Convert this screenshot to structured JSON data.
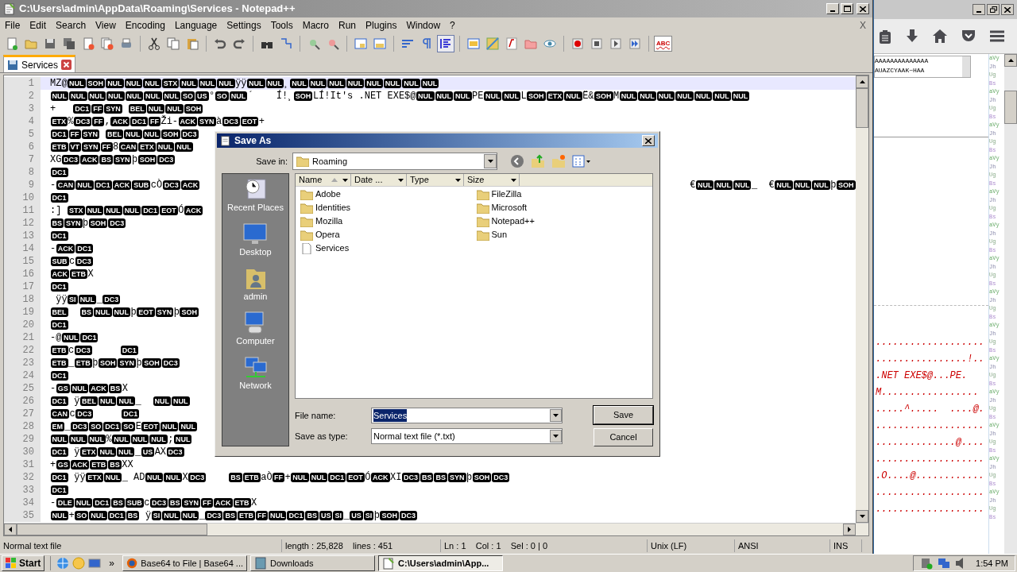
{
  "window": {
    "title": "C:\\Users\\admin\\AppData\\Roaming\\Services - Notepad++",
    "close_doc": "X"
  },
  "menu": [
    "File",
    "Edit",
    "Search",
    "View",
    "Encoding",
    "Language",
    "Settings",
    "Tools",
    "Macro",
    "Run",
    "Plugins",
    "Window",
    "?"
  ],
  "toolbar": [
    {
      "pressed": false
    },
    {
      "pressed": false
    },
    {
      "pressed": false
    },
    {
      "pressed": false
    },
    {
      "pressed": false
    },
    {
      "pressed": false
    },
    {
      "pressed": false
    },
    {
      "pressed": false
    },
    {
      "pressed": false
    },
    {
      "pressed": false
    },
    {
      "pressed": false
    },
    {
      "pressed": false
    },
    {
      "pressed": false
    },
    {
      "pressed": false
    },
    {
      "pressed": false
    },
    {
      "pressed": false
    },
    {
      "pressed": false
    },
    {
      "pressed": false
    },
    {
      "pressed": false
    },
    {
      "pressed": false
    },
    {
      "pressed": true
    },
    {
      "pressed": false
    },
    {
      "pressed": false
    },
    {
      "pressed": false
    },
    {
      "pressed": false
    },
    {
      "pressed": false
    },
    {
      "pressed": false
    },
    {
      "pressed": false
    },
    {
      "pressed": false
    },
    {
      "pressed": false
    }
  ],
  "spell_button": "ABC",
  "tabs": [
    {
      "label": "Services",
      "selected": true
    }
  ],
  "editor": {
    "lines": [
      {
        "number": "1",
        "current": true,
        "segments": [
          {
            "kind": "text",
            "text": "MZ@"
          },
          {
            "kind": "ctrl",
            "text": "NUL"
          },
          {
            "kind": "ctrl",
            "text": "SOH"
          },
          {
            "kind": "ctrl",
            "text": "NUL"
          },
          {
            "kind": "ctrl",
            "text": "NUL"
          },
          {
            "kind": "ctrl",
            "text": "NUL"
          },
          {
            "kind": "ctrl",
            "text": "STX"
          },
          {
            "kind": "ctrl",
            "text": "NUL"
          },
          {
            "kind": "ctrl",
            "text": "NUL"
          },
          {
            "kind": "ctrl",
            "text": "NUL"
          },
          {
            "kind": "text",
            "text": "ÿÿ"
          },
          {
            "kind": "ctrl",
            "text": "NUL"
          },
          {
            "kind": "ctrl",
            "text": "NUL"
          },
          {
            "kind": "text",
            "text": "¸"
          },
          {
            "kind": "ctrl",
            "text": "NUL"
          },
          {
            "kind": "ctrl",
            "text": "NUL"
          },
          {
            "kind": "ctrl",
            "text": "NUL"
          },
          {
            "kind": "ctrl",
            "text": "NUL"
          },
          {
            "kind": "ctrl",
            "text": "NUL"
          },
          {
            "kind": "ctrl",
            "text": "NUL"
          },
          {
            "kind": "ctrl",
            "text": "NUL"
          },
          {
            "kind": "ctrl",
            "text": "NUL"
          }
        ]
      },
      {
        "number": "2",
        "current": false,
        "segments": [
          {
            "kind": "ctrl",
            "text": "NUL"
          },
          {
            "kind": "ctrl",
            "text": "NUL"
          },
          {
            "kind": "ctrl",
            "text": "NUL"
          },
          {
            "kind": "ctrl",
            "text": "NUL"
          },
          {
            "kind": "ctrl",
            "text": "NUL"
          },
          {
            "kind": "ctrl",
            "text": "NUL"
          },
          {
            "kind": "ctrl",
            "text": "NUL"
          },
          {
            "kind": "ctrl",
            "text": "SO"
          },
          {
            "kind": "ctrl",
            "text": "US"
          },
          {
            "kind": "text",
            "text": "°"
          },
          {
            "kind": "ctrl",
            "text": "SO"
          },
          {
            "kind": "ctrl",
            "text": "NUL"
          },
          {
            "kind": "text",
            "text": "´    Í!¸"
          },
          {
            "kind": "ctrl",
            "text": "SOH"
          },
          {
            "kind": "text",
            "text": "LÍ!It's .NET EXE$@"
          },
          {
            "kind": "ctrl",
            "text": "NUL"
          },
          {
            "kind": "ctrl",
            "text": "NUL"
          },
          {
            "kind": "ctrl",
            "text": "NUL"
          },
          {
            "kind": "text",
            "text": "PE"
          },
          {
            "kind": "ctrl",
            "text": "NUL"
          },
          {
            "kind": "ctrl",
            "text": "NUL"
          },
          {
            "kind": "text",
            "text": "L"
          },
          {
            "kind": "ctrl",
            "text": "SOH"
          },
          {
            "kind": "ctrl",
            "text": "ETX"
          },
          {
            "kind": "ctrl",
            "text": "NUL"
          },
          {
            "kind": "text",
            "text": "Ë&"
          },
          {
            "kind": "ctrl",
            "text": "SOH"
          },
          {
            "kind": "text",
            "text": "M"
          },
          {
            "kind": "ctrl",
            "text": "NUL"
          },
          {
            "kind": "ctrl",
            "text": "NUL"
          },
          {
            "kind": "ctrl",
            "text": "NUL"
          },
          {
            "kind": "ctrl",
            "text": "NUL"
          },
          {
            "kind": "ctrl",
            "text": "NUL"
          },
          {
            "kind": "ctrl",
            "text": "NUL"
          },
          {
            "kind": "ctrl",
            "text": "NUL"
          }
        ]
      },
      {
        "number": "3",
        "current": false,
        "segments": [
          {
            "kind": "text",
            "text": "+   "
          },
          {
            "kind": "ctrl",
            "text": "DC1"
          },
          {
            "kind": "ctrl",
            "text": "FF"
          },
          {
            "kind": "ctrl",
            "text": "SYN"
          },
          {
            "kind": "gap"
          },
          {
            "kind": "ctrl",
            "text": "BEL"
          },
          {
            "kind": "ctrl",
            "text": "NUL"
          },
          {
            "kind": "ctrl",
            "text": "NUL"
          },
          {
            "kind": "ctrl",
            "text": "SOH"
          }
        ]
      },
      {
        "number": "4",
        "current": false,
        "segments": [
          {
            "kind": "ctrl",
            "text": "ETX"
          },
          {
            "kind": "text",
            "text": "%"
          },
          {
            "kind": "ctrl",
            "text": "DC3"
          },
          {
            "kind": "ctrl",
            "text": "FF"
          },
          {
            "kind": "text",
            "text": ","
          },
          {
            "kind": "ctrl",
            "text": "ACK"
          },
          {
            "kind": "ctrl",
            "text": "DC1"
          },
          {
            "kind": "ctrl",
            "text": "FF"
          },
          {
            "kind": "text",
            "text": "Ži-"
          },
          {
            "kind": "ctrl",
            "text": "ACK"
          },
          {
            "kind": "ctrl",
            "text": "SYN"
          },
          {
            "kind": "text",
            "text": "à"
          },
          {
            "kind": "ctrl",
            "text": "DC3"
          },
          {
            "kind": "ctrl",
            "text": "EOT"
          },
          {
            "kind": "text",
            "text": "+"
          }
        ]
      },
      {
        "number": "5",
        "current": false,
        "segments": [
          {
            "kind": "ctrl",
            "text": "DC1"
          },
          {
            "kind": "ctrl",
            "text": "FF"
          },
          {
            "kind": "ctrl",
            "text": "SYN"
          },
          {
            "kind": "gap"
          },
          {
            "kind": "ctrl",
            "text": "BEL"
          },
          {
            "kind": "ctrl",
            "text": "NUL"
          },
          {
            "kind": "ctrl",
            "text": "NUL"
          },
          {
            "kind": "ctrl",
            "text": "SOH"
          },
          {
            "kind": "ctrl",
            "text": "DC3"
          }
        ]
      },
      {
        "number": "6",
        "current": false,
        "segments": [
          {
            "kind": "ctrl",
            "text": "ETB"
          },
          {
            "kind": "ctrl",
            "text": "VT"
          },
          {
            "kind": "ctrl",
            "text": "SYN"
          },
          {
            "kind": "ctrl",
            "text": "FF"
          },
          {
            "kind": "text",
            "text": "8"
          },
          {
            "kind": "ctrl",
            "text": "CAN"
          },
          {
            "kind": "ctrl",
            "text": "ETX"
          },
          {
            "kind": "ctrl",
            "text": "NUL"
          },
          {
            "kind": "ctrl",
            "text": "NUL"
          }
        ]
      },
      {
        "number": "7",
        "current": false,
        "segments": [
          {
            "kind": "text",
            "text": "XG"
          },
          {
            "kind": "ctrl",
            "text": "DC3"
          },
          {
            "kind": "ctrl",
            "text": "ACK"
          },
          {
            "kind": "ctrl",
            "text": "BS"
          },
          {
            "kind": "ctrl",
            "text": "SYN"
          },
          {
            "kind": "text",
            "text": "þ"
          },
          {
            "kind": "ctrl",
            "text": "SOH"
          },
          {
            "kind": "ctrl",
            "text": "DC3"
          }
        ]
      },
      {
        "number": "8",
        "current": false,
        "segments": [
          {
            "kind": "ctrl",
            "text": "DC1"
          }
        ]
      },
      {
        "number": "9",
        "current": false,
        "segments": [
          {
            "kind": "text",
            "text": "-"
          },
          {
            "kind": "ctrl",
            "text": "CAN"
          },
          {
            "kind": "ctrl",
            "text": "NUL"
          },
          {
            "kind": "ctrl",
            "text": "DC1"
          },
          {
            "kind": "ctrl",
            "text": "ACK"
          },
          {
            "kind": "ctrl",
            "text": "SUB"
          },
          {
            "kind": "text",
            "text": "cÒ"
          },
          {
            "kind": "ctrl",
            "text": "DC3"
          },
          {
            "kind": "ctrl",
            "text": "ACK"
          }
        ],
        "right_segments": [
          {
            "kind": "text",
            "text": "€"
          },
          {
            "kind": "ctrl",
            "text": "NUL"
          },
          {
            "kind": "ctrl",
            "text": "NUL"
          },
          {
            "kind": "ctrl",
            "text": "NUL"
          },
          {
            "kind": "text",
            "text": "_  €"
          },
          {
            "kind": "ctrl",
            "text": "NUL"
          },
          {
            "kind": "ctrl",
            "text": "NUL"
          },
          {
            "kind": "ctrl",
            "text": "NUL"
          },
          {
            "kind": "text",
            "text": "þ"
          },
          {
            "kind": "ctrl",
            "text": "SOH"
          }
        ]
      },
      {
        "number": "10",
        "current": false,
        "segments": [
          {
            "kind": "ctrl",
            "text": "DC1"
          }
        ]
      },
      {
        "number": "11",
        "current": false,
        "segments": [
          {
            "kind": "text",
            "text": ":] "
          },
          {
            "kind": "ctrl",
            "text": "STX"
          },
          {
            "kind": "ctrl",
            "text": "NUL"
          },
          {
            "kind": "ctrl",
            "text": "NUL"
          },
          {
            "kind": "ctrl",
            "text": "NUL"
          },
          {
            "kind": "ctrl",
            "text": "DC1"
          },
          {
            "kind": "ctrl",
            "text": "EOT"
          },
          {
            "kind": "text",
            "text": "Ó"
          },
          {
            "kind": "ctrl",
            "text": "ACK"
          }
        ]
      },
      {
        "number": "12",
        "current": false,
        "segments": [
          {
            "kind": "ctrl",
            "text": "BS"
          },
          {
            "kind": "ctrl",
            "text": "SYN"
          },
          {
            "kind": "text",
            "text": "þ"
          },
          {
            "kind": "ctrl",
            "text": "SOH"
          },
          {
            "kind": "ctrl",
            "text": "DC3"
          }
        ]
      },
      {
        "number": "13",
        "current": false,
        "segments": [
          {
            "kind": "ctrl",
            "text": "DC1"
          }
        ]
      },
      {
        "number": "14",
        "current": false,
        "segments": [
          {
            "kind": "text",
            "text": "-"
          },
          {
            "kind": "ctrl",
            "text": "ACK"
          },
          {
            "kind": "ctrl",
            "text": "DC1"
          }
        ]
      },
      {
        "number": "15",
        "current": false,
        "segments": [
          {
            "kind": "ctrl",
            "text": "SUB"
          },
          {
            "kind": "text",
            "text": "c"
          },
          {
            "kind": "ctrl",
            "text": "DC3"
          }
        ]
      },
      {
        "number": "16",
        "current": false,
        "segments": [
          {
            "kind": "ctrl",
            "text": "ACK"
          },
          {
            "kind": "ctrl",
            "text": "ETB"
          },
          {
            "kind": "text",
            "text": "X"
          }
        ]
      },
      {
        "number": "17",
        "current": false,
        "segments": [
          {
            "kind": "ctrl",
            "text": "DC1"
          }
        ]
      },
      {
        "number": "18",
        "current": false,
        "segments": [
          {
            "kind": "text",
            "text": " ÿÿ"
          },
          {
            "kind": "ctrl",
            "text": "SI"
          },
          {
            "kind": "ctrl",
            "text": "NUL"
          },
          {
            "kind": "text",
            "text": "_"
          },
          {
            "kind": "ctrl",
            "text": "DC3"
          }
        ]
      },
      {
        "number": "19",
        "current": false,
        "segments": [
          {
            "kind": "ctrl",
            "text": "BEL"
          },
          {
            "kind": "gap"
          },
          {
            "kind": "gap"
          },
          {
            "kind": "ctrl",
            "text": "BS"
          },
          {
            "kind": "ctrl",
            "text": "NUL"
          },
          {
            "kind": "ctrl",
            "text": "NUL"
          },
          {
            "kind": "text",
            "text": "þ"
          },
          {
            "kind": "ctrl",
            "text": "EOT"
          },
          {
            "kind": "ctrl",
            "text": "SYN"
          },
          {
            "kind": "text",
            "text": "þ"
          },
          {
            "kind": "ctrl",
            "text": "SOH"
          }
        ]
      },
      {
        "number": "20",
        "current": false,
        "segments": [
          {
            "kind": "ctrl",
            "text": "DC1"
          }
        ]
      },
      {
        "number": "21",
        "current": false,
        "segments": [
          {
            "kind": "text",
            "text": "-@"
          },
          {
            "kind": "ctrl",
            "text": "NUL"
          },
          {
            "kind": "ctrl",
            "text": "DC1"
          }
        ]
      },
      {
        "number": "22",
        "current": false,
        "segments": [
          {
            "kind": "ctrl",
            "text": "ETB"
          },
          {
            "kind": "text",
            "text": "c"
          },
          {
            "kind": "ctrl",
            "text": "DC3"
          },
          {
            "kind": "gap"
          },
          {
            "kind": "gap"
          },
          {
            "kind": "gap"
          },
          {
            "kind": "gap"
          },
          {
            "kind": "gap"
          },
          {
            "kind": "ctrl",
            "text": "DC1"
          }
        ]
      },
      {
        "number": "23",
        "current": false,
        "segments": [
          {
            "kind": "ctrl",
            "text": "ETB"
          },
          {
            "kind": "text",
            "text": "_"
          },
          {
            "kind": "ctrl",
            "text": "ETB"
          },
          {
            "kind": "text",
            "text": "þ"
          },
          {
            "kind": "ctrl",
            "text": "SOH"
          },
          {
            "kind": "ctrl",
            "text": "SYN"
          },
          {
            "kind": "text",
            "text": "þ"
          },
          {
            "kind": "ctrl",
            "text": "SOH"
          },
          {
            "kind": "ctrl",
            "text": "DC3"
          }
        ]
      },
      {
        "number": "24",
        "current": false,
        "segments": [
          {
            "kind": "ctrl",
            "text": "DC1"
          }
        ]
      },
      {
        "number": "25",
        "current": false,
        "segments": [
          {
            "kind": "text",
            "text": "-"
          },
          {
            "kind": "ctrl",
            "text": "GS"
          },
          {
            "kind": "ctrl",
            "text": "NUL"
          },
          {
            "kind": "ctrl",
            "text": "ACK"
          },
          {
            "kind": "ctrl",
            "text": "BS"
          },
          {
            "kind": "text",
            "text": "X"
          }
        ]
      },
      {
        "number": "26",
        "current": false,
        "segments": [
          {
            "kind": "ctrl",
            "text": "DC1"
          },
          {
            "kind": "text",
            "text": " ÿ"
          },
          {
            "kind": "ctrl",
            "text": "BEL"
          },
          {
            "kind": "ctrl",
            "text": "NUL"
          },
          {
            "kind": "ctrl",
            "text": "NUL"
          },
          {
            "kind": "text",
            "text": "_  "
          },
          {
            "kind": "ctrl",
            "text": "NUL"
          },
          {
            "kind": "ctrl",
            "text": "NUL"
          }
        ]
      },
      {
        "number": "27",
        "current": false,
        "segments": [
          {
            "kind": "ctrl",
            "text": "CAN"
          },
          {
            "kind": "text",
            "text": "c"
          },
          {
            "kind": "ctrl",
            "text": "DC3"
          },
          {
            "kind": "gap"
          },
          {
            "kind": "gap"
          },
          {
            "kind": "gap"
          },
          {
            "kind": "gap"
          },
          {
            "kind": "gap"
          },
          {
            "kind": "ctrl",
            "text": "DC1"
          }
        ]
      },
      {
        "number": "28",
        "current": false,
        "segments": [
          {
            "kind": "ctrl",
            "text": "EM"
          },
          {
            "kind": "text",
            "text": "_"
          },
          {
            "kind": "ctrl",
            "text": "DC3"
          },
          {
            "kind": "ctrl",
            "text": "SO"
          },
          {
            "kind": "ctrl",
            "text": "DC1"
          },
          {
            "kind": "ctrl",
            "text": "SO"
          },
          {
            "kind": "text",
            "text": "E"
          },
          {
            "kind": "ctrl",
            "text": "EOT"
          },
          {
            "kind": "ctrl",
            "text": "NUL"
          },
          {
            "kind": "ctrl",
            "text": "NUL"
          }
        ]
      },
      {
        "number": "29",
        "current": false,
        "segments": [
          {
            "kind": "ctrl",
            "text": "NUL"
          },
          {
            "kind": "ctrl",
            "text": "NUL"
          },
          {
            "kind": "ctrl",
            "text": "NUL"
          },
          {
            "kind": "text",
            "text": "%"
          },
          {
            "kind": "ctrl",
            "text": "NUL"
          },
          {
            "kind": "ctrl",
            "text": "NUL"
          },
          {
            "kind": "ctrl",
            "text": "NUL"
          },
          {
            "kind": "text",
            "text": ";"
          },
          {
            "kind": "ctrl",
            "text": "NUL"
          }
        ]
      },
      {
        "number": "30",
        "current": false,
        "segments": [
          {
            "kind": "ctrl",
            "text": "DC1"
          },
          {
            "kind": "text",
            "text": " ÿ"
          },
          {
            "kind": "ctrl",
            "text": "ETX"
          },
          {
            "kind": "ctrl",
            "text": "NUL"
          },
          {
            "kind": "ctrl",
            "text": "NUL"
          },
          {
            "kind": "text",
            "text": "_"
          },
          {
            "kind": "ctrl",
            "text": "US"
          },
          {
            "kind": "text",
            "text": "AX"
          },
          {
            "kind": "ctrl",
            "text": "DC3"
          }
        ]
      },
      {
        "number": "31",
        "current": false,
        "segments": [
          {
            "kind": "text",
            "text": "+"
          },
          {
            "kind": "ctrl",
            "text": "GS"
          },
          {
            "kind": "ctrl",
            "text": "ACK"
          },
          {
            "kind": "ctrl",
            "text": "ETB"
          },
          {
            "kind": "ctrl",
            "text": "BS"
          },
          {
            "kind": "text",
            "text": "XX"
          }
        ]
      },
      {
        "number": "32",
        "current": false,
        "segments": [
          {
            "kind": "ctrl",
            "text": "DC1"
          },
          {
            "kind": "text",
            "text": " ÿÿ"
          },
          {
            "kind": "ctrl",
            "text": "ETX"
          },
          {
            "kind": "ctrl",
            "text": "NUL"
          },
          {
            "kind": "text",
            "text": "_ AD"
          },
          {
            "kind": "ctrl",
            "text": "NUL"
          },
          {
            "kind": "ctrl",
            "text": "NUL"
          },
          {
            "kind": "text",
            "text": "X"
          },
          {
            "kind": "ctrl",
            "text": "DC3"
          },
          {
            "kind": "gap"
          },
          {
            "kind": "gap"
          },
          {
            "kind": "gap"
          },
          {
            "kind": "gap"
          },
          {
            "kind": "ctrl",
            "text": "BS"
          },
          {
            "kind": "ctrl",
            "text": "ETB"
          },
          {
            "kind": "text",
            "text": "aÒ"
          },
          {
            "kind": "ctrl",
            "text": "FF"
          },
          {
            "kind": "text",
            "text": "+"
          },
          {
            "kind": "ctrl",
            "text": "NUL"
          },
          {
            "kind": "ctrl",
            "text": "NUL"
          },
          {
            "kind": "ctrl",
            "text": "DC1"
          },
          {
            "kind": "ctrl",
            "text": "EOT"
          },
          {
            "kind": "text",
            "text": "Ó"
          },
          {
            "kind": "ctrl",
            "text": "ACK"
          },
          {
            "kind": "text",
            "text": "XI"
          },
          {
            "kind": "ctrl",
            "text": "DC3"
          },
          {
            "kind": "ctrl",
            "text": "BS"
          },
          {
            "kind": "ctrl",
            "text": "BS"
          },
          {
            "kind": "ctrl",
            "text": "SYN"
          },
          {
            "kind": "text",
            "text": "þ"
          },
          {
            "kind": "ctrl",
            "text": "SOH"
          },
          {
            "kind": "ctrl",
            "text": "DC3"
          }
        ]
      },
      {
        "number": "33",
        "current": false,
        "segments": [
          {
            "kind": "ctrl",
            "text": "DC1"
          }
        ]
      },
      {
        "number": "34",
        "current": false,
        "segments": [
          {
            "kind": "text",
            "text": "-"
          },
          {
            "kind": "ctrl",
            "text": "DLE"
          },
          {
            "kind": "ctrl",
            "text": "NUL"
          },
          {
            "kind": "ctrl",
            "text": "DC1"
          },
          {
            "kind": "ctrl",
            "text": "BS"
          },
          {
            "kind": "ctrl",
            "text": "SUB"
          },
          {
            "kind": "text",
            "text": "c"
          },
          {
            "kind": "ctrl",
            "text": "DC3"
          },
          {
            "kind": "ctrl",
            "text": "BS"
          },
          {
            "kind": "ctrl",
            "text": "SYN"
          },
          {
            "kind": "ctrl",
            "text": "FF"
          },
          {
            "kind": "ctrl",
            "text": "ACK"
          },
          {
            "kind": "ctrl",
            "text": "ETB"
          },
          {
            "kind": "text",
            "text": "X"
          }
        ]
      },
      {
        "number": "35",
        "current": false,
        "segments": [
          {
            "kind": "ctrl",
            "text": "NUL"
          },
          {
            "kind": "text",
            "text": "+"
          },
          {
            "kind": "ctrl",
            "text": "SO"
          },
          {
            "kind": "ctrl",
            "text": "NUL"
          },
          {
            "kind": "ctrl",
            "text": "DC1"
          },
          {
            "kind": "ctrl",
            "text": "BS"
          },
          {
            "kind": "text",
            "text": " ÿ"
          },
          {
            "kind": "ctrl",
            "text": "SI"
          },
          {
            "kind": "ctrl",
            "text": "NUL"
          },
          {
            "kind": "ctrl",
            "text": "NUL"
          },
          {
            "kind": "text",
            "text": "_"
          },
          {
            "kind": "ctrl",
            "text": "DC3"
          },
          {
            "kind": "ctrl",
            "text": "BS"
          },
          {
            "kind": "ctrl",
            "text": "ETB"
          },
          {
            "kind": "ctrl",
            "text": "FF"
          },
          {
            "kind": "ctrl",
            "text": "NUL"
          },
          {
            "kind": "ctrl",
            "text": "DC1"
          },
          {
            "kind": "ctrl",
            "text": "BS"
          },
          {
            "kind": "ctrl",
            "text": "US"
          },
          {
            "kind": "ctrl",
            "text": "SI"
          },
          {
            "kind": "text",
            "text": "_"
          },
          {
            "kind": "ctrl",
            "text": "US"
          },
          {
            "kind": "ctrl",
            "text": "SI"
          },
          {
            "kind": "text",
            "text": "þ"
          },
          {
            "kind": "ctrl",
            "text": "SOH"
          },
          {
            "kind": "ctrl",
            "text": "DC3"
          }
        ]
      }
    ]
  },
  "status_bar": [
    "Normal text file",
    "length : 25,828    lines : 451",
    "Ln : 1    Col : 1    Sel : 0 | 0",
    "Unix (LF)",
    "ANSI",
    "INS"
  ],
  "dialog": {
    "title": "Save As",
    "save_in_label": "Save in:",
    "save_in": "Roaming",
    "places": [
      "Recent Places",
      "Desktop",
      "admin",
      "Computer",
      "Network"
    ],
    "columns": [
      "Name",
      "Date ...",
      "Type",
      "Size"
    ],
    "files": [
      {
        "name": "Adobe",
        "kind": "folder"
      },
      {
        "name": "Identities",
        "kind": "folder"
      },
      {
        "name": "Mozilla",
        "kind": "folder"
      },
      {
        "name": "Opera",
        "kind": "folder"
      },
      {
        "name": "Services",
        "kind": "file"
      },
      {
        "name": "FileZilla",
        "kind": "folder"
      },
      {
        "name": "Microsoft",
        "kind": "folder"
      },
      {
        "name": "Notepad++",
        "kind": "folder"
      },
      {
        "name": "Sun",
        "kind": "folder"
      }
    ],
    "file_name_label": "File name:",
    "file_name": "Services",
    "type_label": "Save as type:",
    "type": "Normal text file (*.txt)",
    "buttons": [
      "Save",
      "Cancel"
    ]
  },
  "browser": {
    "text_area": [
      "AAAAAAAAAAAAAA",
      "AUAZCYAAK~HAA"
    ],
    "dump_lines": [
      "...................",
      "................!..",
      ".NET EXE$@...PE.",
      "M.................",
      ".....^.....  ....@.",
      "...................",
      "..............@....",
      "...................",
      ".O....@............",
      "...................",
      "..................."
    ],
    "code_strip": [
      "aVy",
      "Jh",
      "Ug",
      "Bs",
      "aVy",
      "Jh",
      "Ug",
      "Bs",
      "aVy",
      "Jh",
      "Ug",
      "Bs",
      "aVy",
      "Jh",
      "Ug",
      "Bs",
      "aVy",
      "Jh",
      "Ug",
      "Bs",
      "aVy",
      "Jh",
      "Ug",
      "Bs",
      "aVy",
      "Jh",
      "Ug",
      "Bs",
      "aVy",
      "Jh",
      "Ug",
      "Bs",
      "aVy",
      "Jh",
      "Ug",
      "Bs",
      "aVy",
      "Jh",
      "Ug",
      "Bs",
      "aVy",
      "Jh",
      "Ug",
      "Bs",
      "aVy",
      "Jh",
      "Ug",
      "Bs",
      "aVy",
      "Jh",
      "Ug",
      "Bs",
      "aVy",
      "Jh",
      "Ug",
      "Bs"
    ]
  },
  "taskbar": {
    "start": "Start",
    "more": "»",
    "tasks": [
      {
        "label": "Base64 to File | Base64 ...",
        "selected": false
      },
      {
        "label": "Downloads",
        "selected": false
      },
      {
        "label": "C:\\Users\\admin\\App...",
        "selected": true
      }
    ],
    "clock": "1:54 PM"
  }
}
